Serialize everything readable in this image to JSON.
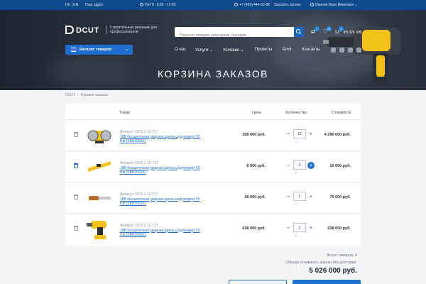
{
  "topbar": {
    "lang": "RU | EN",
    "address": "Наш адрес",
    "hours": "Пн-Пт: 8:00 - 17:00",
    "phone": "+7 (499) 444-32-88",
    "callback": "Заказать звонок",
    "user": "Иванов Иван Иванович"
  },
  "header": {
    "logo": "DCUT",
    "tagline": "Строительные решение для профессионалов",
    "search_placeholder": "Поиск по товарам, категориям, брендам",
    "badges": {
      "compare": "1",
      "favorites": "12",
      "cart": "4"
    },
    "cart_total": "5 026 000",
    "catalog_label": "Каталог товаров",
    "nav": [
      "О нас",
      "Услуги",
      "Условия",
      "Проекты",
      "Блог",
      "Контакты"
    ]
  },
  "page": {
    "title": "КОРЗИНА ЗАКАЗОВ",
    "breadcrumb": [
      "DCUT",
      "Корзина заказов"
    ]
  },
  "table": {
    "columns": {
      "product": "Товар",
      "price": "Цена",
      "qty": "Количество",
      "total": "Стоимость"
    },
    "rows": [
      {
        "sku": "Артикул: DCS 1-12-717",
        "name": "18В бесщеточная ударная дрель-шуруповерт 55 Нм (SBH2052K)",
        "price": "358 000 руб.",
        "qty": "12",
        "total": "4 296 000 руб.",
        "thumb": "grinder",
        "active": false
      },
      {
        "sku": "Артикул: DCS 1-12-717",
        "name": "18В бесщеточная ударная дрель-шуруповерт 55 Нм (SBH2052K)",
        "price": "8 000 руб.",
        "qty": "2",
        "total": "16 000 руб.",
        "thumb": "level",
        "active": true
      },
      {
        "sku": "Артикул: DCS 1-12-717",
        "name": "18В бесщеточная ударная дрель-шуруповерт 55 Нм (SBH2052K)",
        "price": "38 000 руб.",
        "qty": "2",
        "total": "76 000 руб.",
        "thumb": "chisel",
        "active": false
      },
      {
        "sku": "Артикул: DCS 1-12-717",
        "name": "18В бесщеточная ударная дрель-шуруповерт 55 Нм (SBH2052K)",
        "price": "638 000 руб.",
        "qty": "1",
        "total": "638 000 руб.",
        "thumb": "drill",
        "active": false
      }
    ]
  },
  "summary": {
    "count": "Всего товаров: 4",
    "label": "Общая стоимость заказа без доставки:",
    "total": "5 026 000 руб."
  },
  "colors": {
    "brand": "#0f4a8c",
    "accent": "#1e6fd0",
    "tool_yellow": "#f2c21a"
  }
}
